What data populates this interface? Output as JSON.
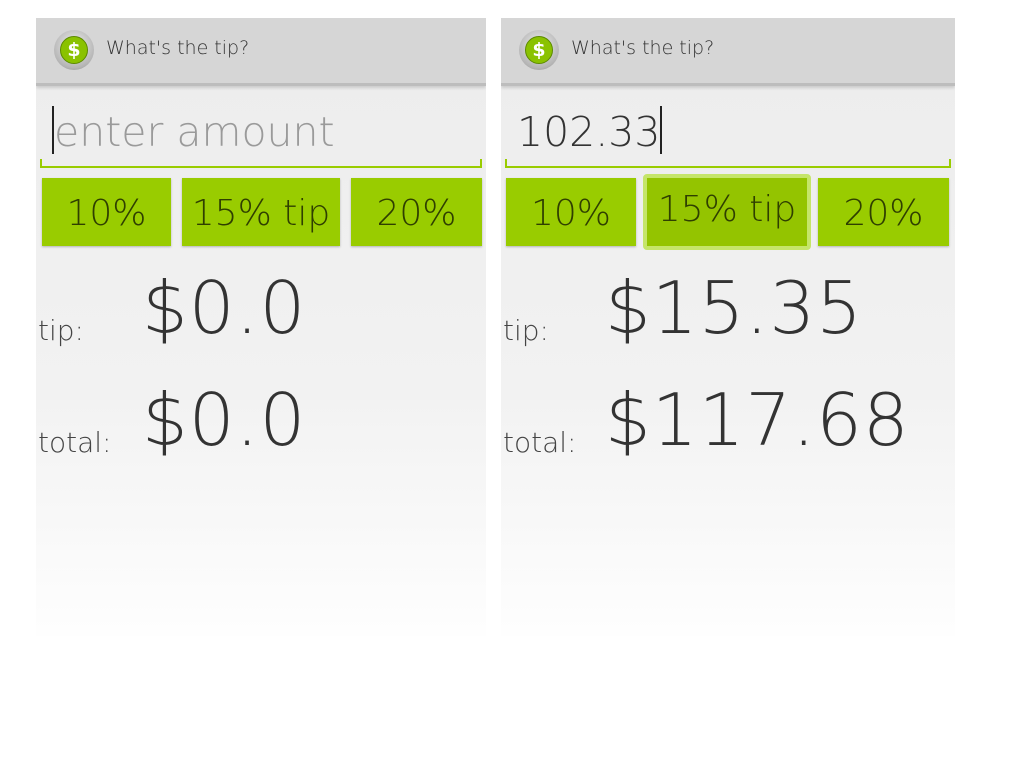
{
  "screens": [
    {
      "action_bar": {
        "icon": "dollar-coin-icon",
        "icon_glyph": "$",
        "title": "What's the tip?"
      },
      "amount": {
        "value": "",
        "placeholder": "enter amount"
      },
      "tip_buttons": [
        "10%",
        "15% tip",
        "20%"
      ],
      "pressed_button": null,
      "tip": {
        "label": "tip:",
        "value": "$0.0"
      },
      "total": {
        "label": "total:",
        "value": "$0.0"
      }
    },
    {
      "action_bar": {
        "icon": "dollar-coin-icon",
        "icon_glyph": "$",
        "title": "What's the tip?"
      },
      "amount": {
        "value": "102.33",
        "placeholder": "enter amount"
      },
      "tip_buttons": [
        "10%",
        "15% tip",
        "20%"
      ],
      "pressed_button": "15% tip",
      "tip": {
        "label": "tip:",
        "value": "$15.35"
      },
      "total": {
        "label": "total:",
        "value": "$117.68"
      }
    }
  ],
  "colors": {
    "accent_green": "#99cc00",
    "action_bar": "#d6d6d6",
    "background": "#efefef"
  }
}
